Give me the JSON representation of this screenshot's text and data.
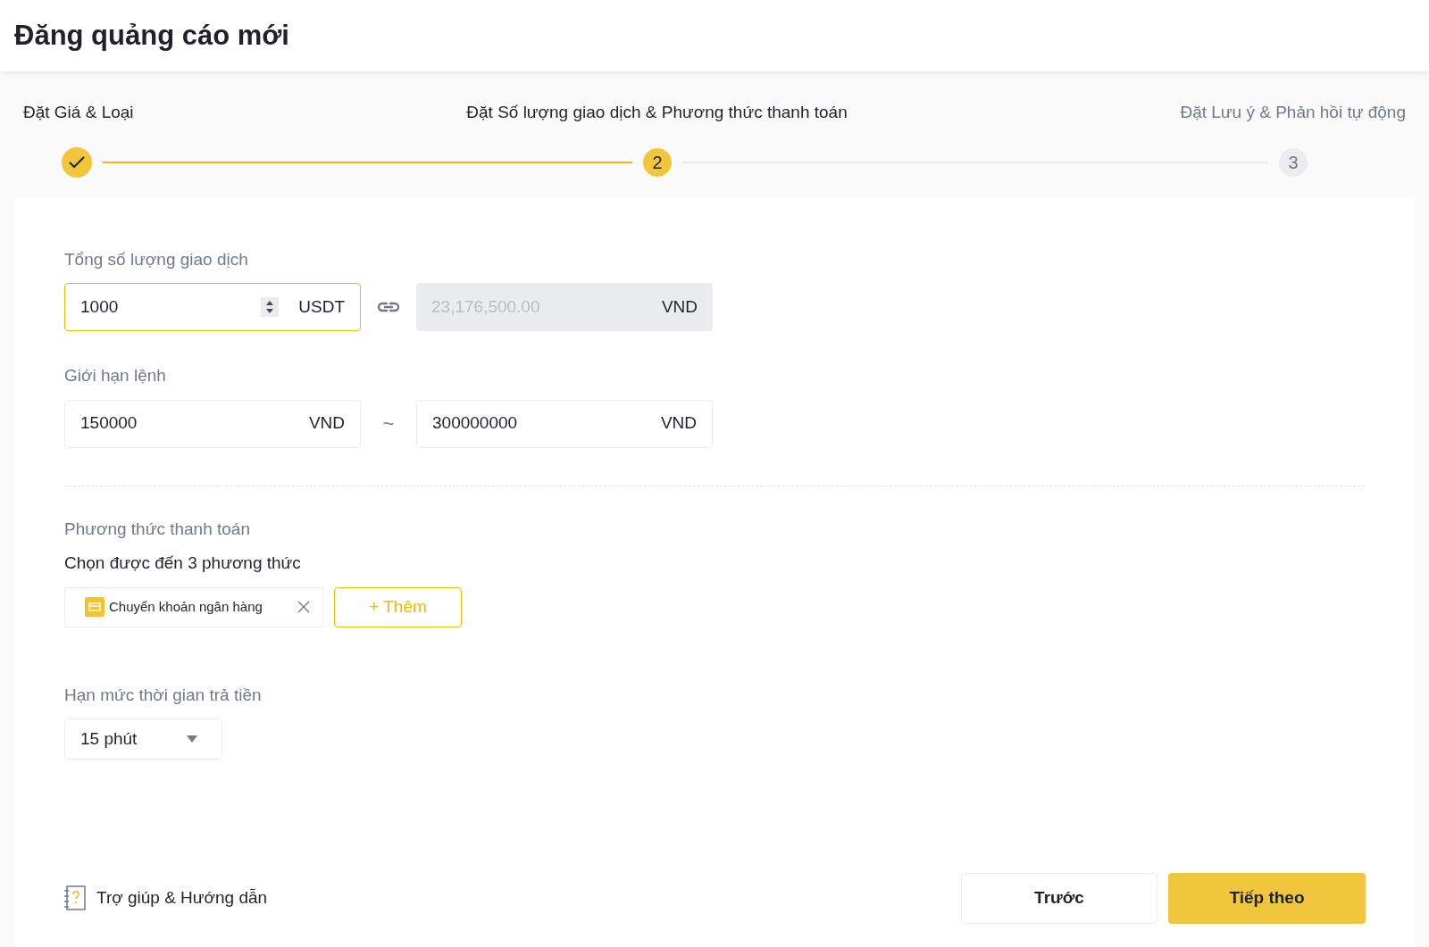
{
  "page": {
    "title": "Đăng quảng cáo mới"
  },
  "steps": [
    {
      "label": "Đặt Giá & Loại",
      "kind": "done"
    },
    {
      "label": "Đặt Số lượng giao dịch & Phương thức thanh toán",
      "number": "2",
      "kind": "current"
    },
    {
      "label": "Đặt Lưu ý & Phản hồi tự động",
      "number": "3",
      "kind": "pending"
    }
  ],
  "total_amount": {
    "label": "Tổng số lượng giao dịch",
    "value": "1000",
    "unit": "USDT",
    "focused": true,
    "converted": {
      "placeholder": "23,176,500.00",
      "unit": "VND",
      "disabled": true
    }
  },
  "order_limit": {
    "label": "Giới hạn lệnh",
    "min": {
      "value": "150000",
      "unit": "VND"
    },
    "separator": "~",
    "max": {
      "value": "300000000",
      "unit": "VND"
    }
  },
  "payment_methods": {
    "label": "Phương thức thanh toán",
    "hint": "Chọn được đến 3 phương thức",
    "selected_methods": [
      {
        "name": "Chuyển khoản ngân hàng"
      }
    ],
    "add_button": "+ Thêm"
  },
  "payment_time_limit": {
    "label": "Hạn mức thời gian trả tiền",
    "value": "15 phút"
  },
  "footer": {
    "help_link": "Trợ giúp & Hướng dẫn",
    "back_button": "Trước",
    "next_button": "Tiếp theo"
  }
}
